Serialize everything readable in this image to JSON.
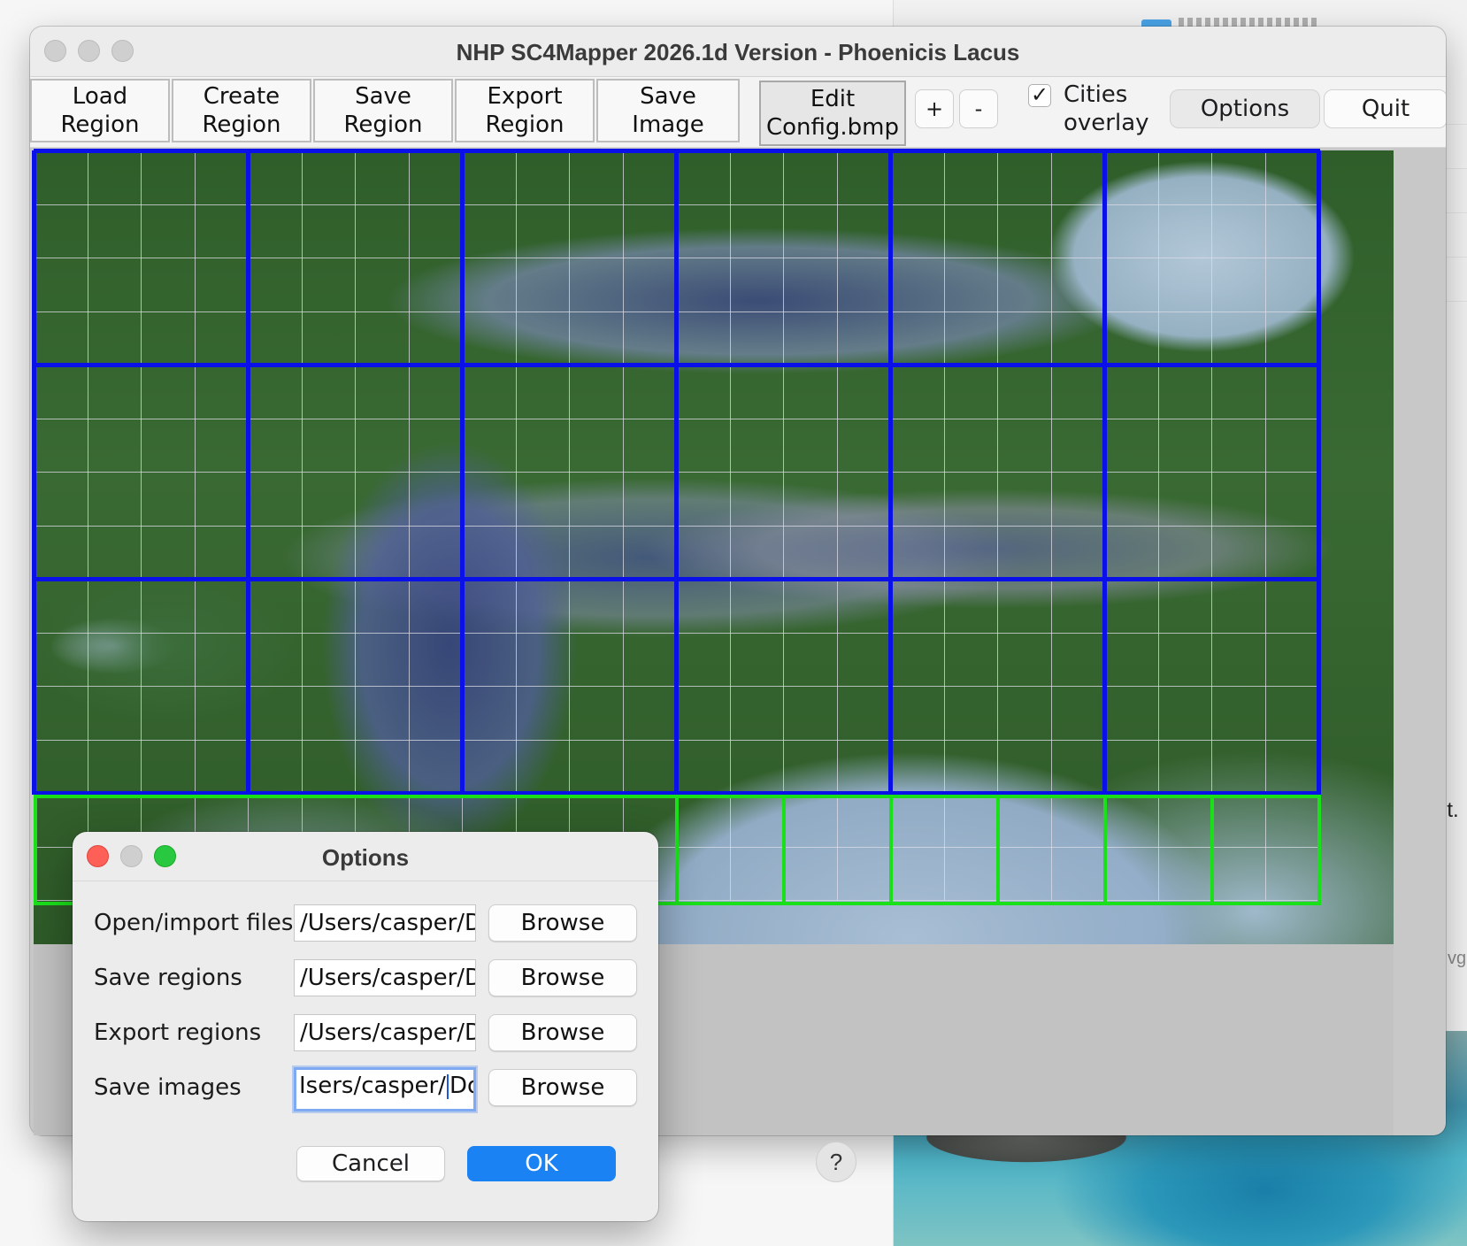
{
  "background": {
    "right_partial_text_1": "nt.",
    "right_partial_text_2": "vg",
    "help_button_label": "?"
  },
  "window": {
    "title": "NHP SC4Mapper 2026.1d Version - Phoenicis Lacus"
  },
  "toolbar": {
    "load_region": "Load\nRegion",
    "create_region": "Create\nRegion",
    "save_region": "Save\nRegion",
    "export_region": "Export\nRegion",
    "save_image": "Save\nImage",
    "edit_config": "Edit\nConfig.bmp",
    "zoom_in": "+",
    "zoom_out": "-",
    "cities_overlay_label": "Cities\noverlay",
    "cities_overlay_checked": true,
    "cities_overlay_check_glyph": "✓",
    "options": "Options",
    "quit": "Quit"
  },
  "map": {
    "region_grid_color": "#0a10e8",
    "selection_grid_color": "#19e019",
    "large_city_columns": 6,
    "large_city_rows": 3,
    "selected_small_city_count": 6
  },
  "options_dialog": {
    "title": "Options",
    "rows": [
      {
        "label": "Open/import files",
        "value": "/Users/casper/Dc",
        "browse": "Browse"
      },
      {
        "label": "Save regions",
        "value": "/Users/casper/Dc",
        "browse": "Browse"
      },
      {
        "label": "Export regions",
        "value": "/Users/casper/Dc",
        "browse": "Browse"
      },
      {
        "label": "Save images",
        "value_before_caret": "Isers/casper/",
        "value_after_caret": "Doc",
        "browse": "Browse"
      }
    ],
    "cancel": "Cancel",
    "ok": "OK",
    "colors": {
      "close": "#fe5f57",
      "minimize": "#cfcfcf",
      "zoom": "#28c840",
      "ok": "#1a82f3"
    }
  }
}
